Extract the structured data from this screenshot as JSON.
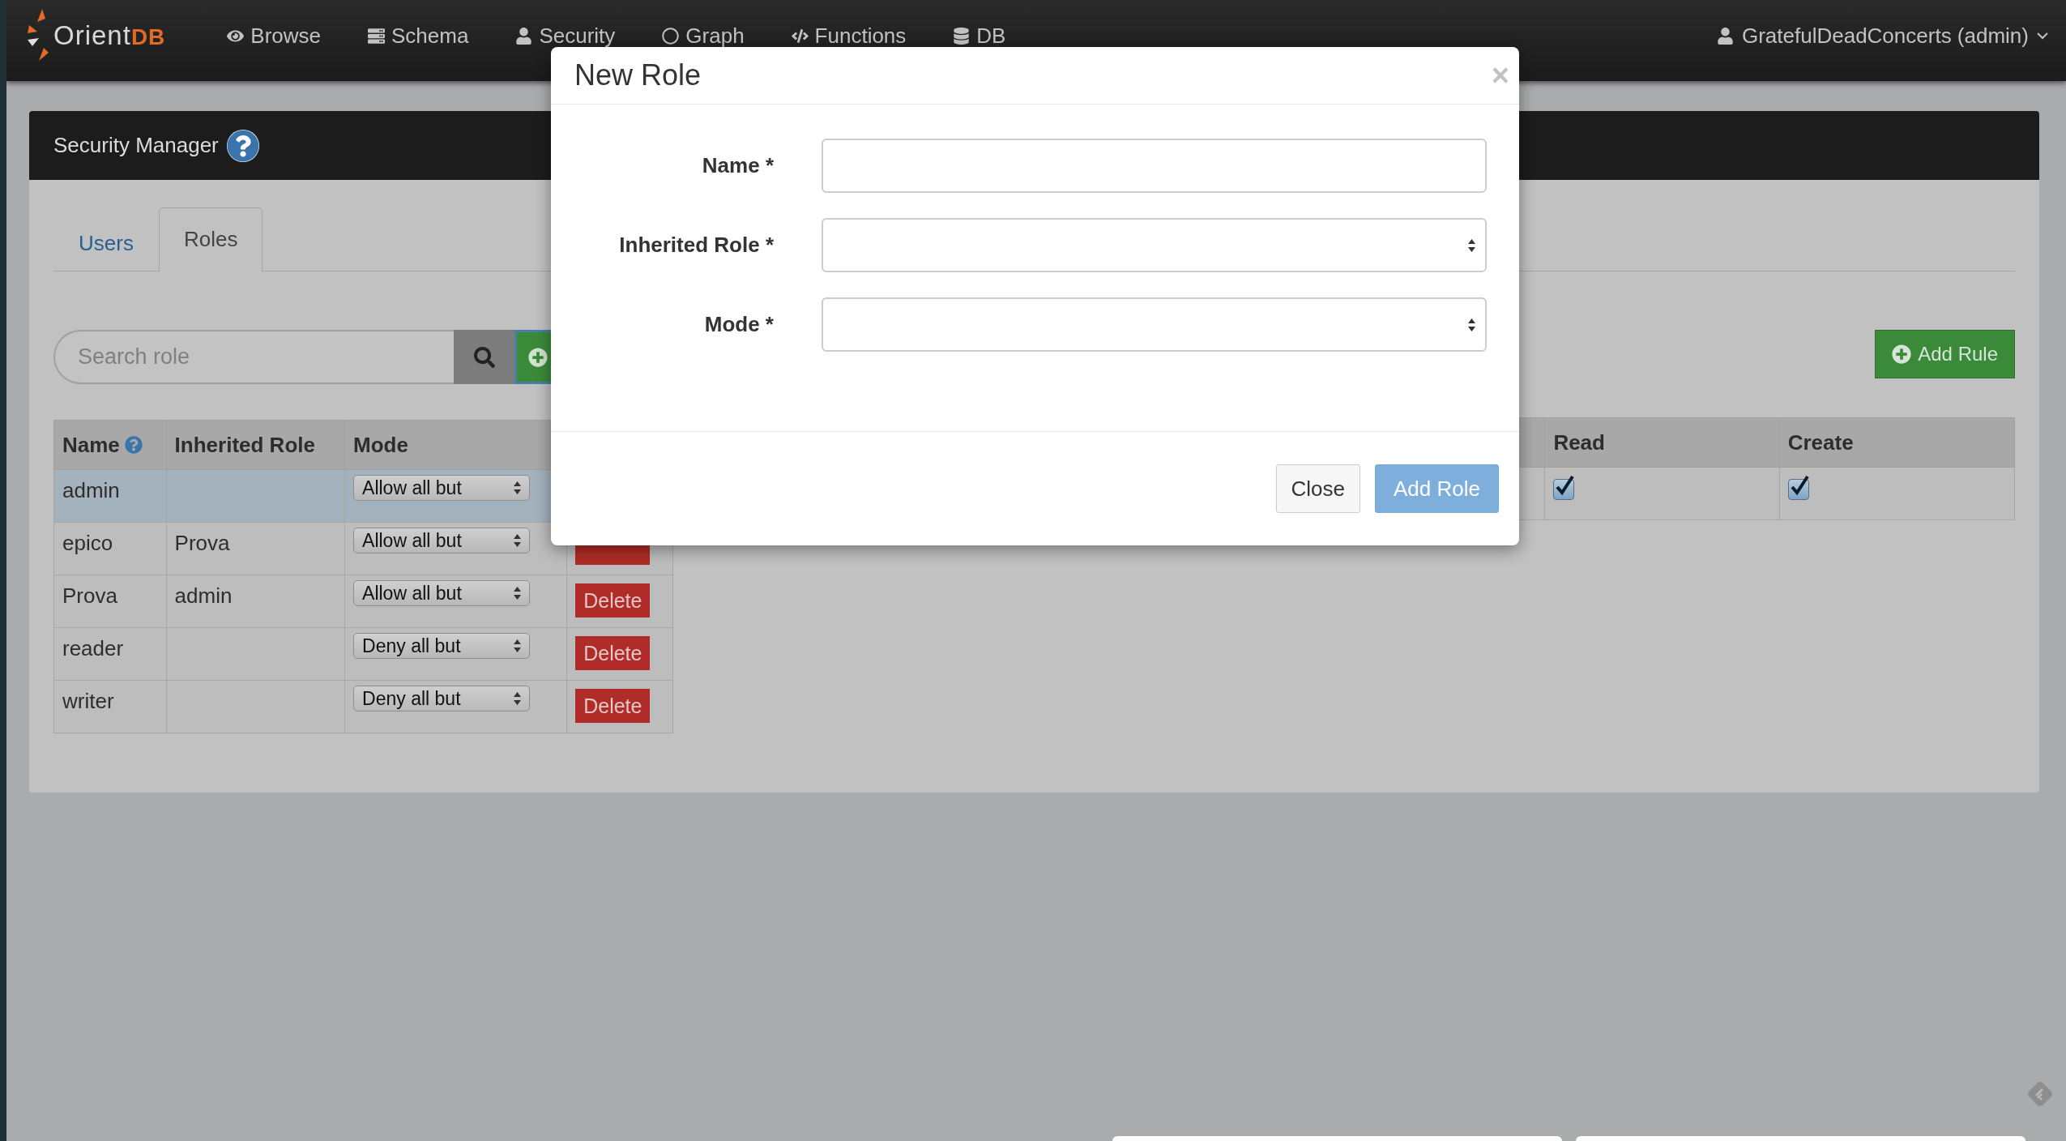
{
  "navbar": {
    "logo": {
      "text": "Orient",
      "accent": "DB"
    },
    "items": [
      {
        "label": "Browse"
      },
      {
        "label": "Schema"
      },
      {
        "label": "Security"
      },
      {
        "label": "Graph"
      },
      {
        "label": "Functions"
      },
      {
        "label": "DB"
      }
    ],
    "user_menu": "GratefulDeadConcerts (admin)"
  },
  "panel": {
    "title": "Security Manager",
    "tabs": [
      {
        "label": "Users",
        "selected": false
      },
      {
        "label": "Roles",
        "selected": true
      }
    ],
    "search": {
      "placeholder": "Search role"
    },
    "roles_table": {
      "columns": [
        "Name",
        "Inherited Role",
        "Mode"
      ],
      "rows": [
        {
          "name": "admin",
          "inherited_role": "",
          "mode": "Allow all but",
          "selected": true
        },
        {
          "name": "epico",
          "inherited_role": "Prova",
          "mode": "Allow all but",
          "delete_button": true,
          "selected": false
        },
        {
          "name": "Prova",
          "inherited_role": "admin",
          "mode": "Allow all but",
          "delete_button": true,
          "delete": "Delete",
          "selected": false
        },
        {
          "name": "reader",
          "inherited_role": "",
          "mode": "Deny all but",
          "delete_button": true,
          "delete": "Delete",
          "selected": false
        },
        {
          "name": "writer",
          "inherited_role": "",
          "mode": "Deny all but",
          "delete_button": true,
          "delete": "Delete",
          "selected": false
        }
      ]
    },
    "add_rule_button": "Add Rule",
    "rules_table": {
      "columns": [
        "Read",
        "Create"
      ],
      "rows": [
        {
          "read": true,
          "create": true
        }
      ]
    }
  },
  "modal": {
    "title": "New Role",
    "close": "×",
    "fields": [
      {
        "kind": "text",
        "label": "Name *"
      },
      {
        "kind": "select",
        "label": "Inherited Role *"
      },
      {
        "kind": "select",
        "label": "Mode *"
      }
    ],
    "buttons": [
      {
        "kind": "default",
        "label": "Close"
      },
      {
        "kind": "primary",
        "label": "Add Role"
      }
    ]
  }
}
